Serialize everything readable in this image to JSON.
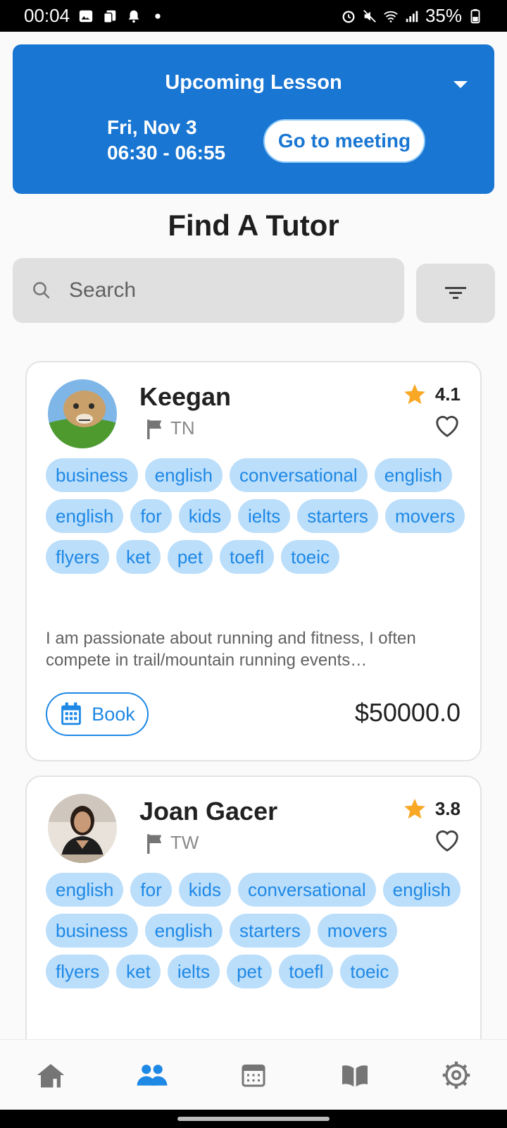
{
  "status_bar": {
    "time": "00:04",
    "battery": "35%"
  },
  "lesson": {
    "title": "Upcoming Lesson",
    "date": "Fri, Nov 3",
    "time": "06:30 - 06:55",
    "button": "Go to meeting"
  },
  "page_title": "Find A Tutor",
  "search": {
    "placeholder": "Search"
  },
  "tutors": [
    {
      "name": "Keegan",
      "country": "TN",
      "rating": "4.1",
      "tags": [
        "business",
        "english",
        "conversational",
        "english",
        "english",
        "for",
        "kids",
        "ielts",
        "starters",
        "movers",
        "flyers",
        "ket",
        "pet",
        "toefl",
        "toeic"
      ],
      "description": "I am passionate about running and fitness, I often compete in trail/mountain running events…",
      "book_label": "Book",
      "price": "$50000.0"
    },
    {
      "name": "Joan Gacer",
      "country": "TW",
      "rating": "3.8",
      "tags": [
        "english",
        "for",
        "kids",
        "conversational",
        "english",
        "business",
        "english",
        "starters",
        "movers",
        "flyers",
        "ket",
        "ielts",
        "pet",
        "toefl",
        "toeic"
      ]
    }
  ],
  "colors": {
    "primary": "#1976d2",
    "tag_bg": "#bbdefb",
    "tag_text": "#1e88e5",
    "star": "#f9a825"
  },
  "nav_icons": [
    "home-icon",
    "people-icon",
    "calendar-icon",
    "book-open-icon",
    "settings-icon"
  ]
}
